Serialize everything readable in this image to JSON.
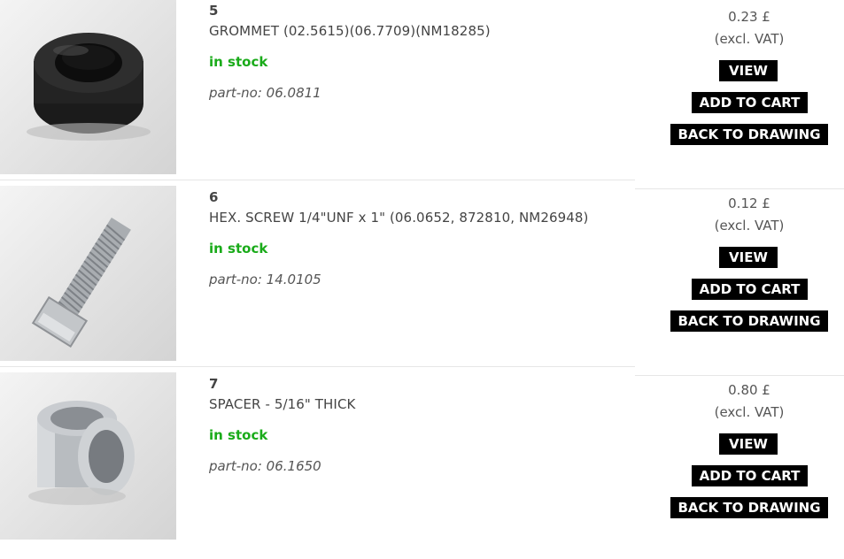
{
  "items": [
    {
      "number": "5",
      "title": "GROMMET (02.5615)(06.7709)(NM18285)",
      "stock": "in stock",
      "part_no": "part-no: 06.0811",
      "price": "0.23 £",
      "vat": "(excl. VAT)",
      "image": "grommet-photo"
    },
    {
      "number": "6",
      "title": "HEX. SCREW 1/4\"UNF x 1\" (06.0652, 872810, NM26948)",
      "stock": "in stock",
      "part_no": "part-no: 14.0105",
      "price": "0.12 £",
      "vat": "(excl. VAT)",
      "image": "hex-screw-photo"
    },
    {
      "number": "7",
      "title": "SPACER - 5/16\" THICK",
      "stock": "in stock",
      "part_no": "part-no: 06.1650",
      "price": "0.80 £",
      "vat": "(excl. VAT)",
      "image": "spacer-photo"
    }
  ],
  "buttons": {
    "view": "VIEW",
    "add_to_cart": "ADD TO CART",
    "back_to_drawing": "BACK TO DRAWING"
  },
  "colors": {
    "in_stock": "#1aab1a",
    "button_bg": "#000000",
    "button_text": "#ffffff"
  }
}
